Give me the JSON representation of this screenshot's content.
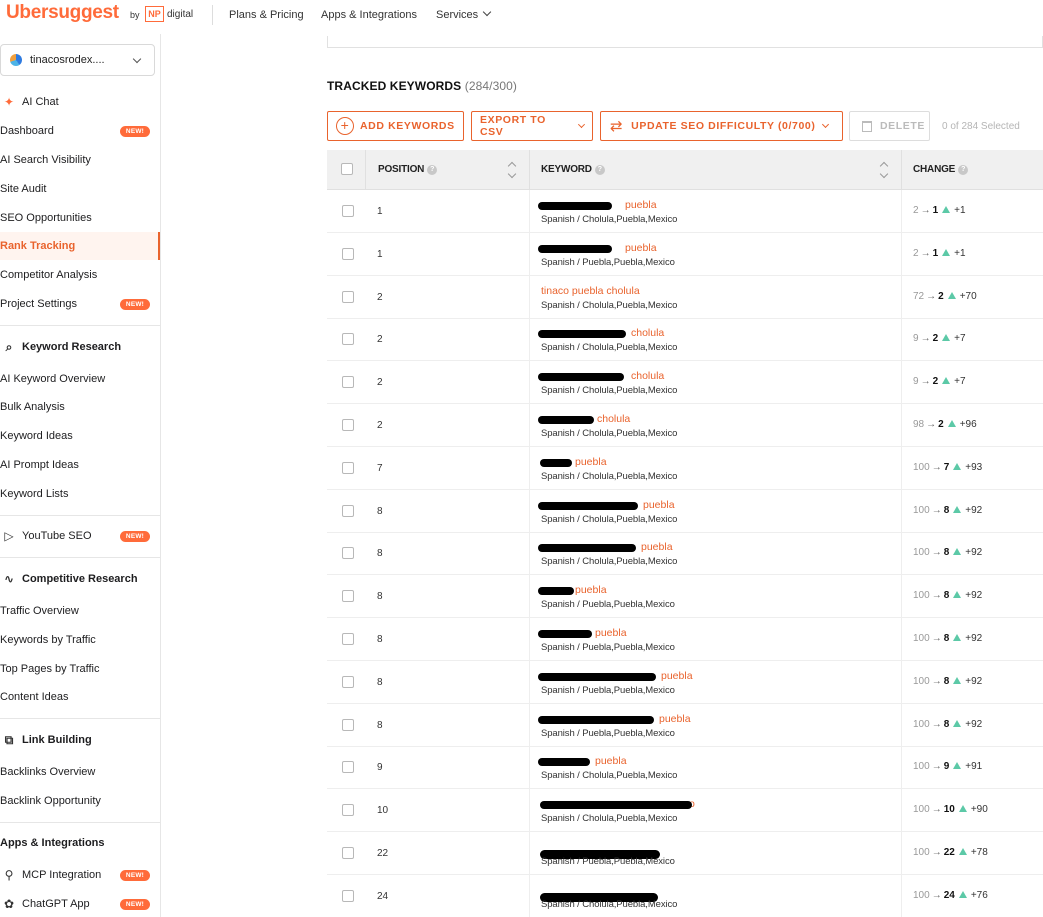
{
  "header": {
    "logo": "Ubersuggest",
    "by": "by",
    "np": "NP",
    "digital": "digital",
    "nav": [
      "Plans & Pricing",
      "Apps & Integrations",
      "Services"
    ]
  },
  "sidebar": {
    "project": "tinacosrodex....",
    "badge_new": "NEW!",
    "items": [
      {
        "label": "AI Chat",
        "icon": "sparkle-icon"
      },
      {
        "label": "Dashboard",
        "new": true
      },
      {
        "label": "AI Search Visibility"
      },
      {
        "label": "Site Audit"
      },
      {
        "label": "SEO Opportunities"
      },
      {
        "label": "Rank Tracking",
        "active": true
      },
      {
        "label": "Competitor Analysis"
      },
      {
        "label": "Project Settings",
        "new": true
      }
    ],
    "keyword_research": {
      "heading": "Keyword Research",
      "items": [
        "AI Keyword Overview",
        "Bulk Analysis",
        "Keyword Ideas",
        "AI Prompt Ideas",
        "Keyword Lists"
      ]
    },
    "youtube": {
      "label": "YouTube SEO"
    },
    "competitive_research": {
      "heading": "Competitive Research",
      "items": [
        "Traffic Overview",
        "Keywords by Traffic",
        "Top Pages by Traffic",
        "Content Ideas"
      ]
    },
    "link_building": {
      "heading": "Link Building",
      "items": [
        "Backlinks Overview",
        "Backlink Opportunity"
      ]
    },
    "apps": {
      "heading": "Apps & Integrations",
      "items": [
        {
          "label": "MCP Integration"
        },
        {
          "label": "ChatGPT App"
        }
      ]
    }
  },
  "main": {
    "title": "TRACKED KEYWORDS",
    "count": "(284/300)",
    "buttons": {
      "add": "ADD KEYWORDS",
      "export": "EXPORT TO CSV",
      "update": "UPDATE SEO DIFFICULTY (0/700)",
      "delete": "DELETE"
    },
    "selected": "0 of 284 Selected",
    "columns": {
      "position": "POSITION",
      "keyword": "KEYWORD",
      "change": "CHANGE"
    },
    "arrow": "→",
    "rows": [
      {
        "position": "1",
        "kw": "puebla",
        "loc": "Spanish / Cholula,Puebla,Mexico",
        "from": "2",
        "to": "1",
        "delta": "+1"
      },
      {
        "position": "1",
        "kw": "puebla",
        "loc": "Spanish / Puebla,Puebla,Mexico",
        "from": "2",
        "to": "1",
        "delta": "+1"
      },
      {
        "position": "2",
        "kw": "tinaco puebla cholula",
        "loc": "Spanish / Cholula,Puebla,Mexico",
        "from": "72",
        "to": "2",
        "delta": "+70"
      },
      {
        "position": "2",
        "kw": "cholula",
        "loc": "Spanish / Cholula,Puebla,Mexico",
        "from": "9",
        "to": "2",
        "delta": "+7"
      },
      {
        "position": "2",
        "kw": "cholula",
        "loc": "Spanish / Cholula,Puebla,Mexico",
        "from": "9",
        "to": "2",
        "delta": "+7"
      },
      {
        "position": "2",
        "kw": "cholula",
        "loc": "Spanish / Cholula,Puebla,Mexico",
        "from": "98",
        "to": "2",
        "delta": "+96"
      },
      {
        "position": "7",
        "kw": "puebla",
        "loc": "Spanish / Cholula,Puebla,Mexico",
        "from": "100",
        "to": "7",
        "delta": "+93"
      },
      {
        "position": "8",
        "kw": "puebla",
        "loc": "Spanish / Cholula,Puebla,Mexico",
        "from": "100",
        "to": "8",
        "delta": "+92"
      },
      {
        "position": "8",
        "kw": "puebla",
        "loc": "Spanish / Cholula,Puebla,Mexico",
        "from": "100",
        "to": "8",
        "delta": "+92"
      },
      {
        "position": "8",
        "kw": "puebla",
        "loc": "Spanish / Puebla,Puebla,Mexico",
        "from": "100",
        "to": "8",
        "delta": "+92"
      },
      {
        "position": "8",
        "kw": "puebla",
        "loc": "Spanish / Puebla,Puebla,Mexico",
        "from": "100",
        "to": "8",
        "delta": "+92"
      },
      {
        "position": "8",
        "kw": "puebla",
        "loc": "Spanish / Puebla,Puebla,Mexico",
        "from": "100",
        "to": "8",
        "delta": "+92"
      },
      {
        "position": "8",
        "kw": "puebla",
        "loc": "Spanish / Puebla,Puebla,Mexico",
        "from": "100",
        "to": "8",
        "delta": "+92"
      },
      {
        "position": "9",
        "kw": "puebla",
        "loc": "Spanish / Cholula,Puebla,Mexico",
        "from": "100",
        "to": "9",
        "delta": "+91"
      },
      {
        "position": "10",
        "kw": "o",
        "loc": "Spanish / Cholula,Puebla,Mexico",
        "from": "100",
        "to": "10",
        "delta": "+90"
      },
      {
        "position": "22",
        "kw": "",
        "loc": "Spanish / Puebla,Puebla,Mexico",
        "from": "100",
        "to": "22",
        "delta": "+78"
      },
      {
        "position": "24",
        "kw": "",
        "loc": "Spanish / Cholula,Puebla,Mexico",
        "from": "100",
        "to": "24",
        "delta": "+76"
      }
    ]
  }
}
